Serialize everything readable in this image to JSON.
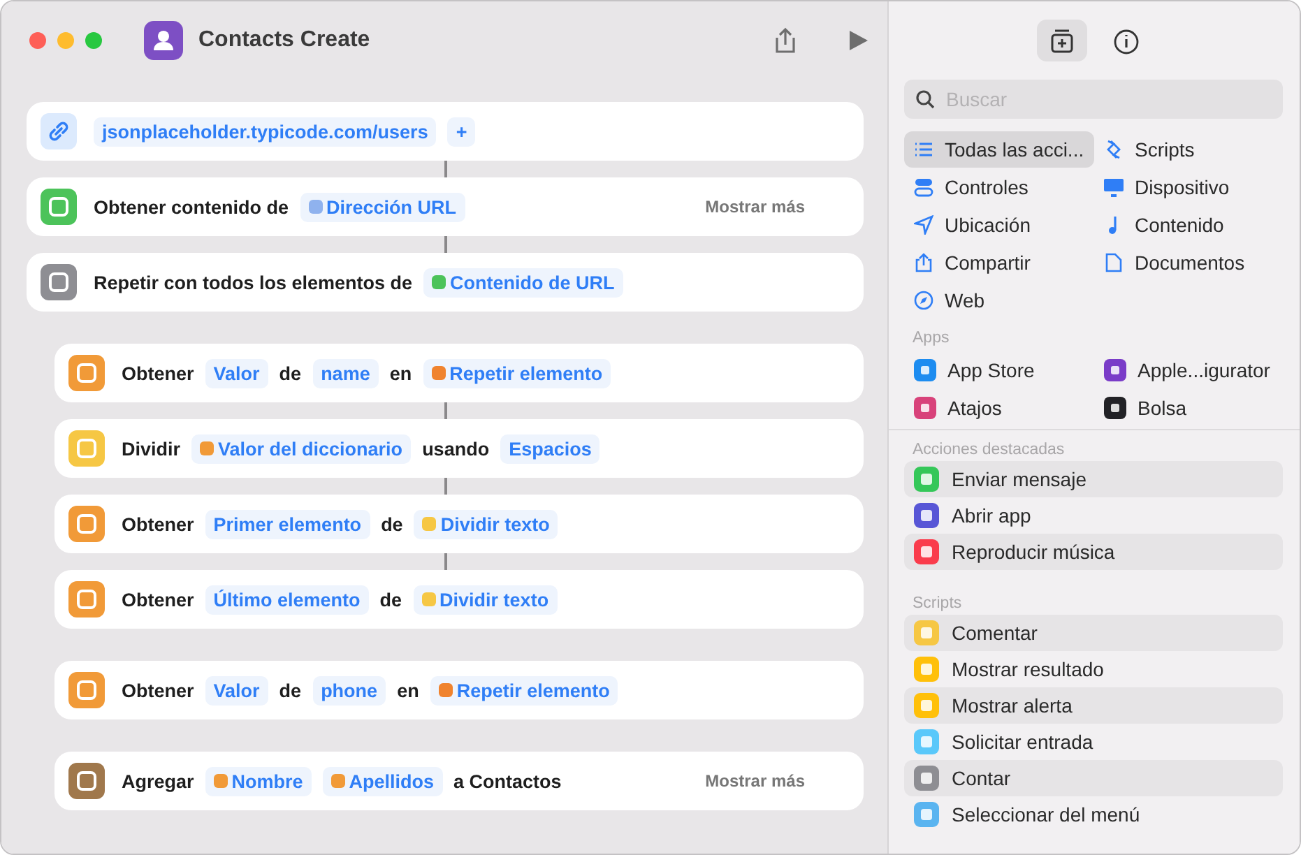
{
  "window": {
    "title": "Contacts Create"
  },
  "actions": [
    {
      "kind": "url",
      "color": "#dceafd",
      "nested": false,
      "parts": [
        {
          "kind": "token",
          "text": "jsonplaceholder.typicode.com/users"
        },
        {
          "kind": "token",
          "text": "+"
        }
      ]
    },
    {
      "kind": "action",
      "color": "#4cc35a",
      "nested": false,
      "connector": true,
      "parts": [
        {
          "kind": "text",
          "text": "Obtener contenido de"
        },
        {
          "kind": "token",
          "text": "Dirección URL",
          "color": "#8fb2ee"
        }
      ],
      "more": "Mostrar más"
    },
    {
      "kind": "action",
      "color": "#8e8e93",
      "nested": false,
      "connector": true,
      "parts": [
        {
          "kind": "text",
          "text": "Repetir con todos los elementos de"
        },
        {
          "kind": "token",
          "text": "Contenido de URL",
          "color": "#4cc35a"
        }
      ]
    },
    {
      "kind": "action",
      "color": "#f19a38",
      "nested": true,
      "connector": false,
      "parts": [
        {
          "kind": "text",
          "text": "Obtener"
        },
        {
          "kind": "token",
          "text": "Valor"
        },
        {
          "kind": "text",
          "text": "de"
        },
        {
          "kind": "token",
          "text": "name"
        },
        {
          "kind": "text",
          "text": "en"
        },
        {
          "kind": "token",
          "text": "Repetir elemento",
          "color": "#f0832e"
        }
      ]
    },
    {
      "kind": "action",
      "color": "#f6c744",
      "nested": true,
      "connector": true,
      "parts": [
        {
          "kind": "text",
          "text": "Dividir"
        },
        {
          "kind": "token",
          "text": "Valor del diccionario",
          "color": "#f19a38"
        },
        {
          "kind": "text",
          "text": "usando"
        },
        {
          "kind": "token",
          "text": "Espacios"
        }
      ]
    },
    {
      "kind": "action",
      "color": "#f19a38",
      "nested": true,
      "connector": true,
      "parts": [
        {
          "kind": "text",
          "text": "Obtener"
        },
        {
          "kind": "token",
          "text": "Primer elemento"
        },
        {
          "kind": "text",
          "text": "de"
        },
        {
          "kind": "token",
          "text": "Dividir texto",
          "color": "#f6c744"
        }
      ]
    },
    {
      "kind": "action",
      "color": "#f19a38",
      "nested": true,
      "connector": true,
      "parts": [
        {
          "kind": "text",
          "text": "Obtener"
        },
        {
          "kind": "token",
          "text": "Último elemento"
        },
        {
          "kind": "text",
          "text": "de"
        },
        {
          "kind": "token",
          "text": "Dividir texto",
          "color": "#f6c744"
        }
      ]
    },
    {
      "kind": "action",
      "color": "#f19a38",
      "nested": true,
      "connector": false,
      "parts": [
        {
          "kind": "text",
          "text": "Obtener"
        },
        {
          "kind": "token",
          "text": "Valor"
        },
        {
          "kind": "text",
          "text": "de"
        },
        {
          "kind": "token",
          "text": "phone"
        },
        {
          "kind": "text",
          "text": "en"
        },
        {
          "kind": "token",
          "text": "Repetir elemento",
          "color": "#f0832e"
        }
      ]
    },
    {
      "kind": "action",
      "color": "#a0784c",
      "nested": true,
      "connector": false,
      "parts": [
        {
          "kind": "text",
          "text": "Agregar"
        },
        {
          "kind": "token",
          "text": "Nombre",
          "color": "#f19a38"
        },
        {
          "kind": "token",
          "text": "Apellidos",
          "color": "#f19a38"
        },
        {
          "kind": "text",
          "text": "a Contactos"
        }
      ],
      "more": "Mostrar más"
    }
  ],
  "sidebar": {
    "toolbar": [
      {
        "selected": true
      },
      {
        "selected": false
      }
    ],
    "search": {
      "placeholder": "Buscar"
    },
    "categories": [
      {
        "label": "Todas las acci...",
        "selected": true
      },
      {
        "label": "Scripts",
        "selected": false
      },
      {
        "label": "Controles",
        "selected": false
      },
      {
        "label": "Dispositivo",
        "selected": false
      },
      {
        "label": "Ubicación",
        "selected": false
      },
      {
        "label": "Contenido",
        "selected": false
      },
      {
        "label": "Compartir",
        "selected": false
      },
      {
        "label": "Documentos",
        "selected": false
      },
      {
        "label": "Web",
        "selected": false
      }
    ],
    "apps_heading": "Apps",
    "apps": [
      {
        "label": "App Store",
        "color": "#1d8cf0"
      },
      {
        "label": "Apple...igurator",
        "color": "#7a3cc8"
      },
      {
        "label": "Atajos",
        "color": "#d8427a"
      },
      {
        "label": "Bolsa",
        "color": "#222226"
      }
    ],
    "sections": [
      {
        "heading": "Acciones destacadas",
        "items": [
          {
            "label": "Enviar mensaje",
            "color": "#35c759"
          },
          {
            "label": "Abrir app",
            "color": "#5856d6"
          },
          {
            "label": "Reproducir música",
            "color": "#fa3c4c"
          }
        ]
      },
      {
        "heading": "Scripts",
        "items": [
          {
            "label": "Comentar",
            "color": "#f6c744"
          },
          {
            "label": "Mostrar resultado",
            "color": "#ffc00a"
          },
          {
            "label": "Mostrar alerta",
            "color": "#ffc00a"
          },
          {
            "label": "Solicitar entrada",
            "color": "#5ac8fa"
          },
          {
            "label": "Contar",
            "color": "#8e8e93"
          },
          {
            "label": "Seleccionar del menú",
            "color": "#5ab4f0"
          }
        ]
      }
    ]
  }
}
